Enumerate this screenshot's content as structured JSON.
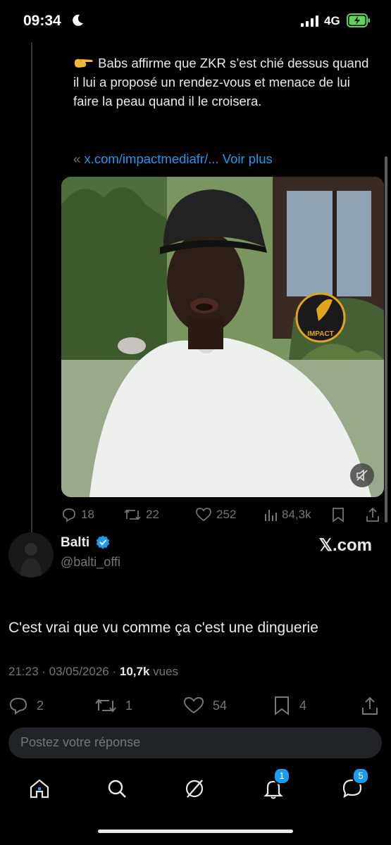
{
  "status_bar": {
    "time": "09:34",
    "network": "4G"
  },
  "quoted_tweet": {
    "text": "Babs affirme que ZKR s’est chié dessus quand il lui a proposé un rendez-vous et menace de lui faire la peau quand il le croisera.",
    "link_prefix": "«",
    "link_text": "x.com/impactmediafr/... Voir plus",
    "video_watermark": "IMPACT",
    "actions": {
      "replies": "18",
      "retweets": "22",
      "likes": "252",
      "views": "84,3k"
    }
  },
  "tweet": {
    "author_name": "Balti",
    "author_handle": "@balti_offi",
    "source": "𝕏.com",
    "text": "C'est vrai que vu comme ça c'est une dinguerie",
    "time": "21:23 · 03/05/2026 ·",
    "views_count": "10,7k",
    "views_label": "vues",
    "actions": {
      "replies": "2",
      "retweets": "1",
      "likes": "54",
      "bookmarks": "4"
    }
  },
  "reply_input": {
    "placeholder": "Postez votre réponse"
  },
  "tabbar": {
    "notifications_badge": "1",
    "messages_badge": "5"
  },
  "colors": {
    "accent": "#1d9bf0",
    "background": "#000000",
    "secondary_text": "#71767b",
    "primary_text": "#e7e9ea"
  }
}
